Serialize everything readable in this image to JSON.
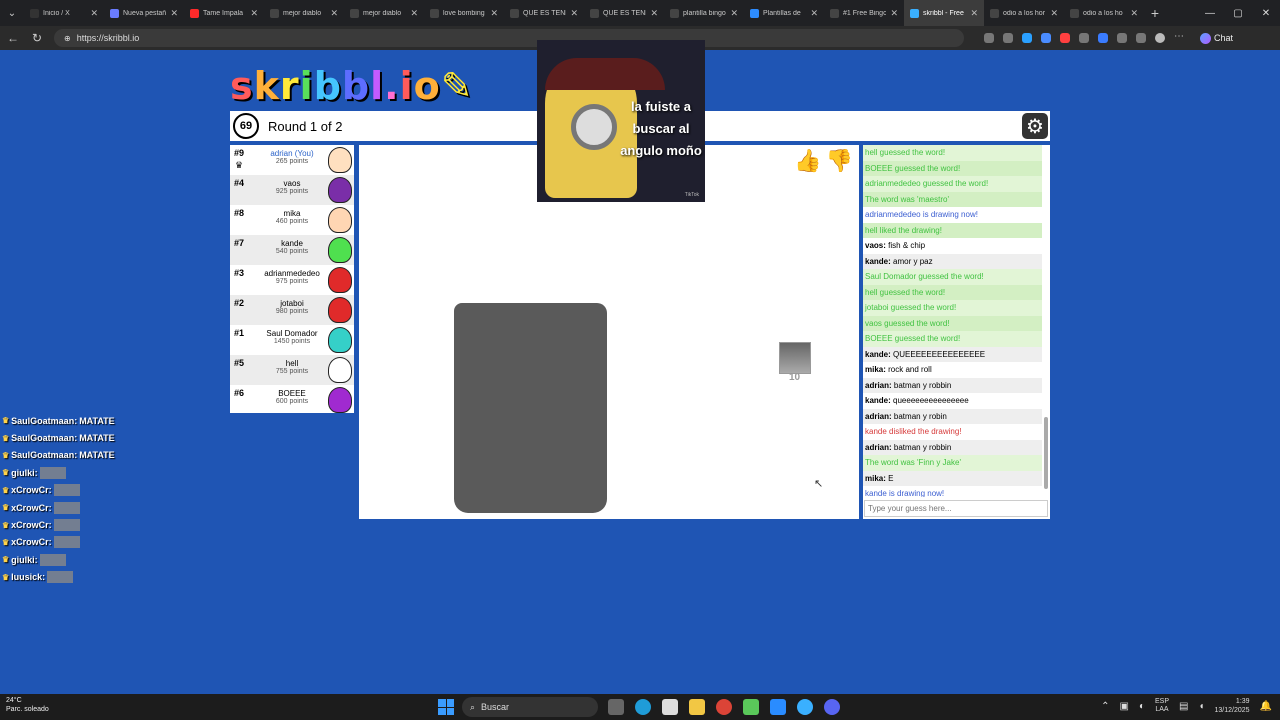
{
  "browser": {
    "tabs": [
      {
        "title": "Inicio / X",
        "color": "#333333",
        "active": false
      },
      {
        "title": "Nueva pestaña",
        "color": "#6a7cff",
        "active": false
      },
      {
        "title": "Tame Impala",
        "color": "#ff2a2a",
        "active": false
      },
      {
        "title": "mejor diablo",
        "color": "#444444",
        "active": false
      },
      {
        "title": "mejor diablo",
        "color": "#444444",
        "active": false
      },
      {
        "title": "love bombing",
        "color": "#444444",
        "active": false
      },
      {
        "title": "QUE ES TENER",
        "color": "#444444",
        "active": false
      },
      {
        "title": "QUE ES TENER",
        "color": "#444444",
        "active": false
      },
      {
        "title": "plantilla bingo",
        "color": "#444444",
        "active": false
      },
      {
        "title": "Plantillas de",
        "color": "#2d8cff",
        "active": false
      },
      {
        "title": "#1 Free Bingo",
        "color": "#444444",
        "active": false
      },
      {
        "title": "skribbl - Free",
        "color": "#3ab0ff",
        "active": true
      },
      {
        "title": "odio a los hor",
        "color": "#444444",
        "active": false
      },
      {
        "title": "odio a los ho",
        "color": "#444444",
        "active": false
      }
    ],
    "new_tab": "+",
    "url": "https://skribbl.io",
    "chat_label": "Chat"
  },
  "game": {
    "timer": "69",
    "round": "Round 1 of 2",
    "players": [
      {
        "rank": "#9",
        "name": "adrian (You)",
        "points": "265 points",
        "color": "#ffe0c0",
        "me": true
      },
      {
        "rank": "#4",
        "name": "vaos",
        "points": "925 points",
        "color": "#7a2ea8",
        "me": false
      },
      {
        "rank": "#8",
        "name": "mika",
        "points": "460 points",
        "color": "#ffd6b3",
        "me": false
      },
      {
        "rank": "#7",
        "name": "kande",
        "points": "540 points",
        "color": "#4fe04f",
        "me": false
      },
      {
        "rank": "#3",
        "name": "adrianmededeo",
        "points": "975 points",
        "color": "#e02a2a",
        "me": false
      },
      {
        "rank": "#2",
        "name": "jotaboi",
        "points": "980 points",
        "color": "#e02a2a",
        "me": false
      },
      {
        "rank": "#1",
        "name": "Saul Domador",
        "points": "1450 points",
        "color": "#35d0c8",
        "me": false
      },
      {
        "rank": "#5",
        "name": "hell",
        "points": "755 points",
        "color": "#ffffff",
        "me": false
      },
      {
        "rank": "#6",
        "name": "BOEEE",
        "points": "600 points",
        "color": "#a02ad0",
        "me": false
      }
    ],
    "pointer_label": "10",
    "chat": [
      {
        "type": "g",
        "user": "",
        "text": "hell guessed the word!"
      },
      {
        "type": "g",
        "user": "",
        "text": "BOEEE guessed the word!"
      },
      {
        "type": "g",
        "user": "",
        "text": "adrianmededeo guessed the word!"
      },
      {
        "type": "g",
        "user": "",
        "text": "The word was 'maestro'"
      },
      {
        "type": "b",
        "user": "",
        "text": "adrianmededeo is drawing now!"
      },
      {
        "type": "g",
        "user": "",
        "text": "hell liked the drawing!"
      },
      {
        "type": "n",
        "user": "vaos:",
        "text": "fish & chip"
      },
      {
        "type": "n",
        "user": "kande:",
        "text": "amor y paz"
      },
      {
        "type": "g",
        "user": "",
        "text": "Saul Domador guessed the word!"
      },
      {
        "type": "g",
        "user": "",
        "text": "hell guessed the word!"
      },
      {
        "type": "g",
        "user": "",
        "text": "jotaboi guessed the word!"
      },
      {
        "type": "g",
        "user": "",
        "text": "vaos guessed the word!"
      },
      {
        "type": "g",
        "user": "",
        "text": "BOEEE guessed the word!"
      },
      {
        "type": "n",
        "user": "kande:",
        "text": "QUEEEEEEEEEEEEEEE"
      },
      {
        "type": "n",
        "user": "mika:",
        "text": "rock and roll"
      },
      {
        "type": "n",
        "user": "adrian:",
        "text": "batman y robbin"
      },
      {
        "type": "n",
        "user": "kande:",
        "text": "queeeeeeeeeeeeeee"
      },
      {
        "type": "n",
        "user": "adrian:",
        "text": "batman y robin"
      },
      {
        "type": "r",
        "user": "",
        "text": "kande disliked the drawing!"
      },
      {
        "type": "n",
        "user": "adrian:",
        "text": "batman y robbin"
      },
      {
        "type": "g",
        "user": "",
        "text": "The word was 'Finn y Jake'"
      },
      {
        "type": "n",
        "user": "mika:",
        "text": "E"
      },
      {
        "type": "b",
        "user": "",
        "text": "kande is drawing now!"
      }
    ],
    "guess_placeholder": "Type your guess here..."
  },
  "overlay": {
    "text_lines": [
      "la fuiste a",
      "buscar al",
      "angulo moño"
    ],
    "sub": "TikTok"
  },
  "stream_chat": [
    {
      "user": "SaulGoatmaan:",
      "msg": "MATATE"
    },
    {
      "user": "SaulGoatmaan:",
      "msg": "MATATE"
    },
    {
      "user": "SaulGoatmaan:",
      "msg": "MATATE"
    },
    {
      "user": "giulki:",
      "msg": ""
    },
    {
      "user": "xCrowCr:",
      "msg": ""
    },
    {
      "user": "xCrowCr:",
      "msg": ""
    },
    {
      "user": "xCrowCr:",
      "msg": ""
    },
    {
      "user": "xCrowCr:",
      "msg": ""
    },
    {
      "user": "giulki:",
      "msg": ""
    },
    {
      "user": "luusick:",
      "msg": ""
    }
  ],
  "taskbar": {
    "weather": "24°C",
    "weather_sub": "Parc. soleado",
    "search": "Buscar",
    "lang": "ESP",
    "lang_sub": "LAA",
    "time": "1:39",
    "date": "13/12/2025"
  }
}
